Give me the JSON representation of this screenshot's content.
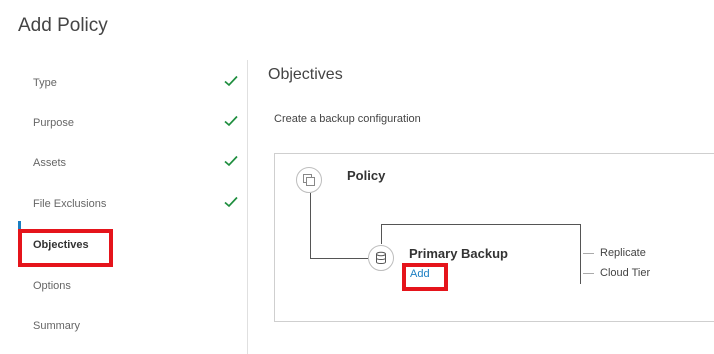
{
  "page": {
    "title": "Add Policy"
  },
  "steps": [
    {
      "label": "Type",
      "completed": true
    },
    {
      "label": "Purpose",
      "completed": true
    },
    {
      "label": "Assets",
      "completed": true
    },
    {
      "label": "File Exclusions",
      "completed": true
    },
    {
      "label": "Objectives",
      "completed": false,
      "active": true
    },
    {
      "label": "Options",
      "completed": false
    },
    {
      "label": "Summary",
      "completed": false
    }
  ],
  "main": {
    "section_title": "Objectives",
    "subtitle": "Create a backup configuration",
    "diagram": {
      "policy_label": "Policy",
      "primary_backup_label": "Primary Backup",
      "add_link": "Add",
      "branches": [
        "Replicate",
        "Cloud Tier"
      ]
    }
  },
  "colors": {
    "accent": "#1a7ec2",
    "check": "#1e8e3e",
    "highlight": "#e5141b"
  },
  "icons": {
    "policy_node": "copy-icon",
    "primary_backup_node": "database-icon",
    "step_complete": "checkmark-icon"
  }
}
